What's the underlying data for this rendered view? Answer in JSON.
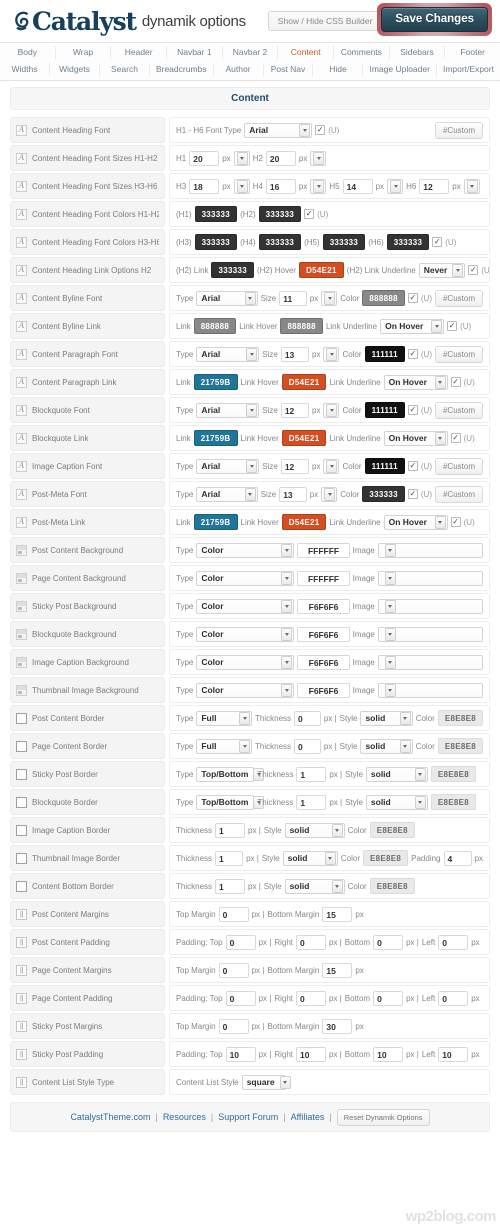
{
  "header": {
    "brand": "Catalyst",
    "brand_sub": "dynamik options",
    "logo_icon": "catalyst-swirl-icon",
    "css_builder_toggle": "Show / Hide CSS Builder",
    "save_button": "Save Changes"
  },
  "nav": {
    "row1": [
      {
        "label": "Body",
        "active": false
      },
      {
        "label": "Wrap",
        "active": false
      },
      {
        "label": "Header",
        "active": false
      },
      {
        "label": "Navbar 1",
        "active": false
      },
      {
        "label": "Navbar 2",
        "active": false
      },
      {
        "label": "Content",
        "active": true
      },
      {
        "label": "Comments",
        "active": false
      },
      {
        "label": "Sidebars",
        "active": false
      },
      {
        "label": "Footer",
        "active": false
      }
    ],
    "row2": [
      {
        "label": "Widths",
        "active": false
      },
      {
        "label": "Widgets",
        "active": false
      },
      {
        "label": "Search",
        "active": false
      },
      {
        "label": "Breadcrumbs",
        "active": false
      },
      {
        "label": "Author",
        "active": false
      },
      {
        "label": "Post Nav",
        "active": false
      },
      {
        "label": "Hide",
        "active": false
      },
      {
        "label": "Image Uploader",
        "active": false
      },
      {
        "label": "Import/Export",
        "active": false
      }
    ]
  },
  "section": {
    "title": "Content"
  },
  "colors": {
    "accent_blue": "#21759B",
    "accent_orange": "#D54E21",
    "dark_text": "#333333",
    "grey_text": "#888888",
    "near_black": "#111111",
    "light_border": "#E8E8E8"
  },
  "labels": {
    "type": "Type",
    "size": "Size",
    "color": "Color",
    "px": "px",
    "u": "(U)",
    "custom": "#Custom",
    "link": "Link",
    "link_hover": "Link Hover",
    "link_underline": "Link Underline",
    "image": "Image",
    "thickness": "Thickness",
    "style": "Style",
    "padding": "Padding",
    "pipe": "|",
    "px_pipe": "px |",
    "top_margin": "Top Margin",
    "bottom_margin": "Bottom Margin",
    "padding_top": "Padding: Top",
    "right": "Right",
    "bottom": "Bottom",
    "left": "Left",
    "h1h6_font_type": "H1 - H6 Font Type",
    "h1": "H1",
    "h2": "H2",
    "h3": "H3",
    "h4": "H4",
    "h5": "H5",
    "h6": "H6",
    "p_h1": "(H1)",
    "p_h2": "(H2)",
    "p_h3": "(H3)",
    "p_h4": "(H4)",
    "p_h5": "(H5)",
    "p_h6": "(H6)",
    "h2_link": "(H2) Link",
    "h2_hover": "(H2) Hover",
    "h2_underline": "(H2) Link Underline",
    "content_list_style": "Content List Style"
  },
  "rows": [
    {
      "id": "content-heading-font",
      "icon": "font-icon",
      "label": "Content Heading Font",
      "kind": "heading-font",
      "font": "Arial",
      "checked": true
    },
    {
      "id": "content-heading-font-sizes-h1-h2",
      "icon": "font-icon",
      "label": "Content Heading Font Sizes H1-H2",
      "kind": "sizes2",
      "s1": "20",
      "s2": "20"
    },
    {
      "id": "content-heading-font-sizes-h3-h6",
      "icon": "font-icon",
      "label": "Content Heading Font Sizes H3-H6",
      "kind": "sizes4",
      "s3": "18",
      "s4": "16",
      "s5": "14",
      "s6": "12"
    },
    {
      "id": "content-heading-font-colors-h1-h2",
      "icon": "font-icon",
      "label": "Content Heading Font Colors H1-H2",
      "kind": "colors2",
      "c1": "333333",
      "c2": "333333",
      "checked": true
    },
    {
      "id": "content-heading-font-colors-h3-h6",
      "icon": "font-icon",
      "label": "Content Heading Font Colors H3-H6",
      "kind": "colors4",
      "c3": "333333",
      "c4": "333333",
      "c5": "333333",
      "c6": "333333",
      "checked": true
    },
    {
      "id": "content-heading-link-options-h2",
      "icon": "font-icon",
      "label": "Content Heading Link Options H2",
      "kind": "headlink",
      "link": "333333",
      "hover": "D54E21",
      "underline": "Never",
      "checked": true
    },
    {
      "id": "content-byline-font",
      "icon": "font-icon",
      "label": "Content Byline Font",
      "kind": "font",
      "font": "Arial",
      "size": "11",
      "color": "888888",
      "color_style": "grey",
      "checked": true
    },
    {
      "id": "content-byline-link",
      "icon": "font-icon",
      "label": "Content Byline Link",
      "kind": "link",
      "link": "888888",
      "link_style": "grey",
      "hover": "888888",
      "hover_style": "grey",
      "underline": "On Hover",
      "checked": true
    },
    {
      "id": "content-paragraph-font",
      "icon": "font-icon",
      "label": "Content Paragraph Font",
      "kind": "font",
      "font": "Arial",
      "size": "13",
      "color": "111111",
      "color_style": "black",
      "checked": true
    },
    {
      "id": "content-paragraph-link",
      "icon": "font-icon",
      "label": "Content Paragraph Link",
      "kind": "link",
      "link": "21759B",
      "link_style": "blue",
      "hover": "D54E21",
      "hover_style": "orange",
      "underline": "On Hover",
      "checked": true
    },
    {
      "id": "blockquote-font",
      "icon": "font-icon",
      "label": "Blockquote Font",
      "kind": "font",
      "font": "Arial",
      "size": "12",
      "color": "111111",
      "color_style": "black",
      "checked": true
    },
    {
      "id": "blockquote-link",
      "icon": "font-icon",
      "label": "Blockquote Link",
      "kind": "link",
      "link": "21759B",
      "link_style": "blue",
      "hover": "D54E21",
      "hover_style": "orange",
      "underline": "On Hover",
      "checked": true
    },
    {
      "id": "image-caption-font",
      "icon": "font-icon",
      "label": "Image Caption Font",
      "kind": "font",
      "font": "Arial",
      "size": "12",
      "color": "111111",
      "color_style": "black",
      "checked": true
    },
    {
      "id": "post-meta-font",
      "icon": "font-icon",
      "label": "Post-Meta Font",
      "kind": "font",
      "font": "Arial",
      "size": "13",
      "color": "333333",
      "color_style": "dark",
      "checked": true
    },
    {
      "id": "post-meta-link",
      "icon": "font-icon",
      "label": "Post-Meta Link",
      "kind": "link",
      "link": "21759B",
      "link_style": "blue",
      "hover": "D54E21",
      "hover_style": "orange",
      "underline": "On Hover",
      "checked": true
    },
    {
      "id": "post-content-background",
      "icon": "background-icon",
      "label": "Post Content Background",
      "kind": "background",
      "type": "Color",
      "color": "FFFFFF",
      "image": ""
    },
    {
      "id": "page-content-background",
      "icon": "background-icon",
      "label": "Page Content Background",
      "kind": "background",
      "type": "Color",
      "color": "FFFFFF",
      "image": ""
    },
    {
      "id": "sticky-post-background",
      "icon": "background-icon",
      "label": "Sticky Post Background",
      "kind": "background",
      "type": "Color",
      "color": "F6F6F6",
      "image": ""
    },
    {
      "id": "blockquote-background",
      "icon": "background-icon",
      "label": "Blockquote Background",
      "kind": "background",
      "type": "Color",
      "color": "F6F6F6",
      "image": ""
    },
    {
      "id": "image-caption-background",
      "icon": "background-icon",
      "label": "Image Caption Background",
      "kind": "background",
      "type": "Color",
      "color": "F6F6F6",
      "image": ""
    },
    {
      "id": "thumbnail-image-background",
      "icon": "background-icon",
      "label": "Thumbnail Image Background",
      "kind": "background",
      "type": "Color",
      "color": "F6F6F6",
      "image": ""
    },
    {
      "id": "post-content-border",
      "icon": "border-icon",
      "label": "Post Content Border",
      "kind": "border-type",
      "type": "Full",
      "thickness": "0",
      "style": "solid",
      "color": "E8E8E8"
    },
    {
      "id": "page-content-border",
      "icon": "border-icon",
      "label": "Page Content Border",
      "kind": "border-type",
      "type": "Full",
      "thickness": "0",
      "style": "solid",
      "color": "E8E8E8"
    },
    {
      "id": "sticky-post-border",
      "icon": "border-icon",
      "label": "Sticky Post Border",
      "kind": "border-type-nb",
      "type": "Top/Bottom",
      "thickness": "1",
      "style": "solid",
      "color": "E8E8E8"
    },
    {
      "id": "blockquote-border",
      "icon": "border-icon",
      "label": "Blockquote Border",
      "kind": "border-type-nb",
      "type": "Top/Bottom",
      "thickness": "1",
      "style": "solid",
      "color": "E8E8E8"
    },
    {
      "id": "image-caption-border",
      "icon": "border-icon",
      "label": "Image Caption Border",
      "kind": "border-simple",
      "thickness": "1",
      "style": "solid",
      "color": "E8E8E8"
    },
    {
      "id": "thumbnail-image-border",
      "icon": "border-icon",
      "label": "Thumbnail Image Border",
      "kind": "border-pad",
      "thickness": "1",
      "style": "solid",
      "color": "E8E8E8",
      "padding": "4"
    },
    {
      "id": "content-bottom-border",
      "icon": "border-icon",
      "label": "Content Bottom Border",
      "kind": "border-simple",
      "thickness": "1",
      "style": "solid",
      "color": "E8E8E8"
    },
    {
      "id": "post-content-margins",
      "icon": "spacing-icon",
      "label": "Post Content Margins",
      "kind": "margins",
      "top": "0",
      "bottom": "15"
    },
    {
      "id": "post-content-padding",
      "icon": "spacing-icon",
      "label": "Post Content Padding",
      "kind": "padding",
      "top": "0",
      "right": "0",
      "bottom": "0",
      "left": "0"
    },
    {
      "id": "page-content-margins",
      "icon": "spacing-icon",
      "label": "Page Content Margins",
      "kind": "margins",
      "top": "0",
      "bottom": "15"
    },
    {
      "id": "page-content-padding",
      "icon": "spacing-icon",
      "label": "Page Content Padding",
      "kind": "padding",
      "top": "0",
      "right": "0",
      "bottom": "0",
      "left": "0"
    },
    {
      "id": "sticky-post-margins",
      "icon": "spacing-icon",
      "label": "Sticky Post Margins",
      "kind": "margins",
      "top": "0",
      "bottom": "30"
    },
    {
      "id": "sticky-post-padding",
      "icon": "spacing-icon",
      "label": "Sticky Post Padding",
      "kind": "padding",
      "top": "10",
      "right": "10",
      "bottom": "10",
      "left": "10"
    },
    {
      "id": "content-list-style-type",
      "icon": "spacing-icon",
      "label": "Content List Style Type",
      "kind": "liststyle",
      "value": "square"
    }
  ],
  "footer": {
    "links": [
      "CatalystTheme.com",
      "Resources",
      "Support Forum",
      "Affiliates"
    ],
    "separator": "|",
    "reset_button": "Reset Dynamik Options"
  },
  "watermark": "wp2blog.com"
}
